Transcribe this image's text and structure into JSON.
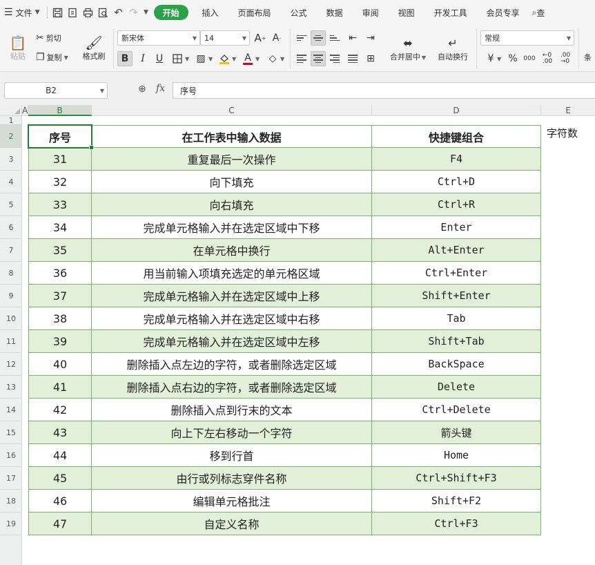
{
  "menu": {
    "file": "文件",
    "tabs": [
      "开始",
      "插入",
      "页面布局",
      "公式",
      "数据",
      "审阅",
      "视图",
      "开发工具",
      "会员专享"
    ],
    "search_partial": "查"
  },
  "ribbon": {
    "paste": "粘贴",
    "cut": "剪切",
    "copy": "复制",
    "format_painter": "格式刷",
    "font_name": "新宋体",
    "font_size": "14",
    "merge_center": "合并居中",
    "wrap_text": "自动换行",
    "number_format": "常规",
    "currency_symbol": "¥",
    "percent_symbol": "%",
    "conditional_partial": "条"
  },
  "formula_bar": {
    "name_box": "B2",
    "fx": "fx",
    "formula_value": "序号"
  },
  "sheet": {
    "columns": [
      "A",
      "B",
      "C",
      "D",
      "E"
    ],
    "row_numbers": [
      "1",
      "2",
      "3",
      "4",
      "5",
      "6",
      "7",
      "8",
      "9",
      "10",
      "11",
      "12",
      "13",
      "14",
      "15",
      "16",
      "17",
      "18",
      "19"
    ],
    "header": {
      "b": "序号",
      "c": "在工作表中输入数据",
      "d": "快捷键组合"
    },
    "e2": "字符数",
    "rows": [
      {
        "num": "31",
        "desc": "重复最后一次操作",
        "key": "F4"
      },
      {
        "num": "32",
        "desc": "向下填充",
        "key": "Ctrl+D"
      },
      {
        "num": "33",
        "desc": "向右填充",
        "key": "Ctrl+R"
      },
      {
        "num": "34",
        "desc": "完成单元格输入并在选定区域中下移",
        "key": "Enter"
      },
      {
        "num": "35",
        "desc": "在单元格中换行",
        "key": "Alt+Enter"
      },
      {
        "num": "36",
        "desc": "用当前输入项填充选定的单元格区域",
        "key": "Ctrl+Enter"
      },
      {
        "num": "37",
        "desc": "完成单元格输入并在选定区域中上移",
        "key": "Shift+Enter"
      },
      {
        "num": "38",
        "desc": "完成单元格输入并在选定区域中右移",
        "key": "Tab"
      },
      {
        "num": "39",
        "desc": "完成单元格输入并在选定区域中左移",
        "key": "Shift+Tab"
      },
      {
        "num": "40",
        "desc": "删除插入点左边的字符，或者删除选定区域",
        "key": "BackSpace"
      },
      {
        "num": "41",
        "desc": "删除插入点右边的字符，或者删除选定区域",
        "key": "Delete"
      },
      {
        "num": "42",
        "desc": "删除插入点到行末的文本",
        "key": "Ctrl+Delete"
      },
      {
        "num": "43",
        "desc": "向上下左右移动一个字符",
        "key": "箭头键"
      },
      {
        "num": "44",
        "desc": "移到行首",
        "key": "Home"
      },
      {
        "num": "45",
        "desc": "由行或列标志穿件名称",
        "key": "Ctrl+Shift+F3"
      },
      {
        "num": "46",
        "desc": "编辑单元格批注",
        "key": "Shift+F2"
      },
      {
        "num": "47",
        "desc": "自定义名称",
        "key": "Ctrl+F3"
      }
    ]
  },
  "colors": {
    "accent_green": "#2aa246",
    "band_green": "#e2efd9",
    "grid_green": "#78b56b",
    "selection_green": "#1e7e34"
  }
}
